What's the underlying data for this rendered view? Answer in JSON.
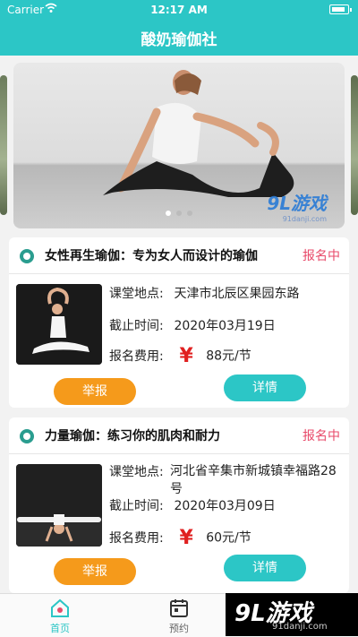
{
  "status_bar": {
    "carrier": "Carrier",
    "time": "12:17 AM"
  },
  "header": {
    "title": "酸奶瑜伽社"
  },
  "banner": {
    "watermark": "9L游戏",
    "watermark_url": "91danji.com",
    "page_count": 3,
    "active_page": 1
  },
  "cards": [
    {
      "title": "女性再生瑜伽：专为女人而设计的瑜伽",
      "status": "报名中",
      "location_label": "课堂地点:",
      "location": "天津市北辰区果园东路",
      "deadline_label": "截止时间:",
      "deadline": "2020年03月19日",
      "fee_label": "报名费用:",
      "fee_symbol": "¥",
      "fee": "88元/节",
      "report_label": "举报",
      "detail_label": "详情"
    },
    {
      "title": "力量瑜伽：练习你的肌肉和耐力",
      "status": "报名中",
      "location_label": "课堂地点:",
      "location": "河北省辛集市新城镇幸福路28号",
      "deadline_label": "截止时间:",
      "deadline": "2020年03月09日",
      "fee_label": "报名费用:",
      "fee_symbol": "¥",
      "fee": "60元/节",
      "report_label": "举报",
      "detail_label": "详情"
    }
  ],
  "tabbar": {
    "home_label": "首页",
    "booking_label": "预约"
  },
  "watermark": {
    "brand": "9L游戏",
    "url": "91danji.com"
  },
  "colors": {
    "accent": "#2cc6c6",
    "report": "#f59a1b",
    "status": "#e84a6a",
    "price": "#e02020"
  }
}
